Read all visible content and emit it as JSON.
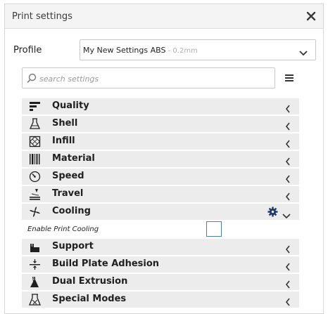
{
  "window": {
    "title": "Print settings"
  },
  "profile": {
    "label": "Profile",
    "name": "My New Settings ABS",
    "sub": " - 0.2mm"
  },
  "search": {
    "placeholder": "search settings"
  },
  "categories": [
    {
      "label": "Quality",
      "icon": "quality-icon"
    },
    {
      "label": "Shell",
      "icon": "shell-icon"
    },
    {
      "label": "Infill",
      "icon": "infill-icon"
    },
    {
      "label": "Material",
      "icon": "material-icon"
    },
    {
      "label": "Speed",
      "icon": "speed-icon"
    },
    {
      "label": "Travel",
      "icon": "travel-icon"
    },
    {
      "label": "Cooling",
      "icon": "cooling-icon",
      "expanded": true
    },
    {
      "label": "Support",
      "icon": "support-icon"
    },
    {
      "label": "Build Plate Adhesion",
      "icon": "adhesion-icon"
    },
    {
      "label": "Dual Extrusion",
      "icon": "dual-extrusion-icon"
    },
    {
      "label": "Special Modes",
      "icon": "special-modes-icon"
    }
  ],
  "cooling_settings": [
    {
      "label": "Enable Print Cooling",
      "checked": false
    }
  ],
  "colors": {
    "accent": "#1a3a6b",
    "category_bg": "#ececec",
    "checkbox_border": "#4a7fb5"
  }
}
